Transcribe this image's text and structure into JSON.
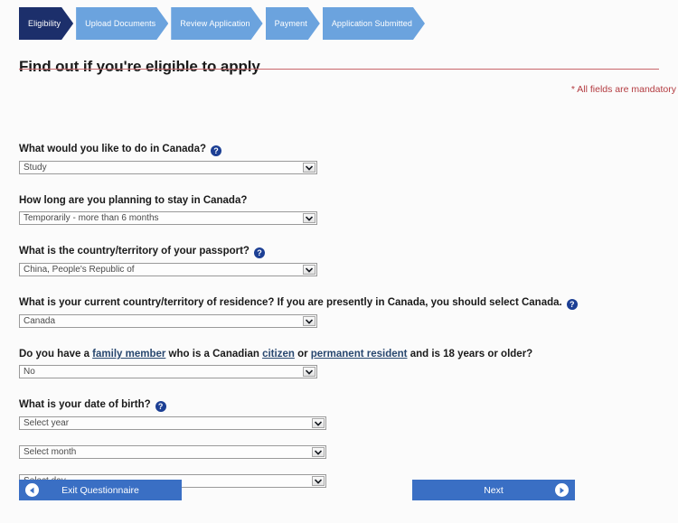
{
  "progress": {
    "steps": [
      {
        "label": "Eligibility",
        "state": "active"
      },
      {
        "label": "Upload Documents",
        "state": "inactive"
      },
      {
        "label": "Review Application",
        "state": "inactive"
      },
      {
        "label": "Payment",
        "state": "inactive"
      },
      {
        "label": "Application Submitted",
        "state": "inactive"
      }
    ],
    "active_color": "#1c2f6b",
    "inactive_color": "#6ba3de"
  },
  "header": {
    "title": "Find out if you're eligible to apply",
    "rule_color": "#c8666b",
    "mandatory_note": "* All fields are mandatory",
    "mandatory_color": "#b33b40"
  },
  "form": {
    "fields": [
      {
        "id": "purpose",
        "label": "What would you like to do in Canada?",
        "help": true,
        "help_icon": "question-mark-circle-icon",
        "value": "Study"
      },
      {
        "id": "duration",
        "label": "How long are you planning to stay in Canada?",
        "help": false,
        "value": "Temporarily - more than 6 months"
      },
      {
        "id": "passport-country",
        "label": "What is the country/territory of your passport?",
        "help": true,
        "help_icon": "question-mark-circle-icon",
        "value": "China, People's Republic of"
      },
      {
        "id": "residence-country",
        "label": "What is your current country/territory of residence? If you are presently in Canada, you should select Canada.",
        "help": true,
        "help_icon": "question-mark-circle-icon",
        "value": "Canada"
      },
      {
        "id": "family-member",
        "label_parts": [
          {
            "text": "Do you have a ",
            "link": false
          },
          {
            "text": "family member",
            "link": true
          },
          {
            "text": " who is a Canadian ",
            "link": false
          },
          {
            "text": "citizen",
            "link": true
          },
          {
            "text": " or ",
            "link": false
          },
          {
            "text": "permanent resident",
            "link": true
          },
          {
            "text": " and is 18 years or older?",
            "link": false
          }
        ],
        "help": false,
        "value": "No"
      }
    ],
    "date_of_birth": {
      "label": "What is your date of birth?",
      "help": true,
      "help_icon": "question-mark-circle-icon",
      "year": "Select year",
      "month": "Select month",
      "day": "Select day"
    },
    "help_glyph": "?"
  },
  "footer": {
    "exit_label": "Exit Questionnaire",
    "exit_icon": "arrow-left-circle-icon",
    "next_label": "Next",
    "next_icon": "arrow-right-circle-icon",
    "button_color": "#3a6fc4"
  }
}
